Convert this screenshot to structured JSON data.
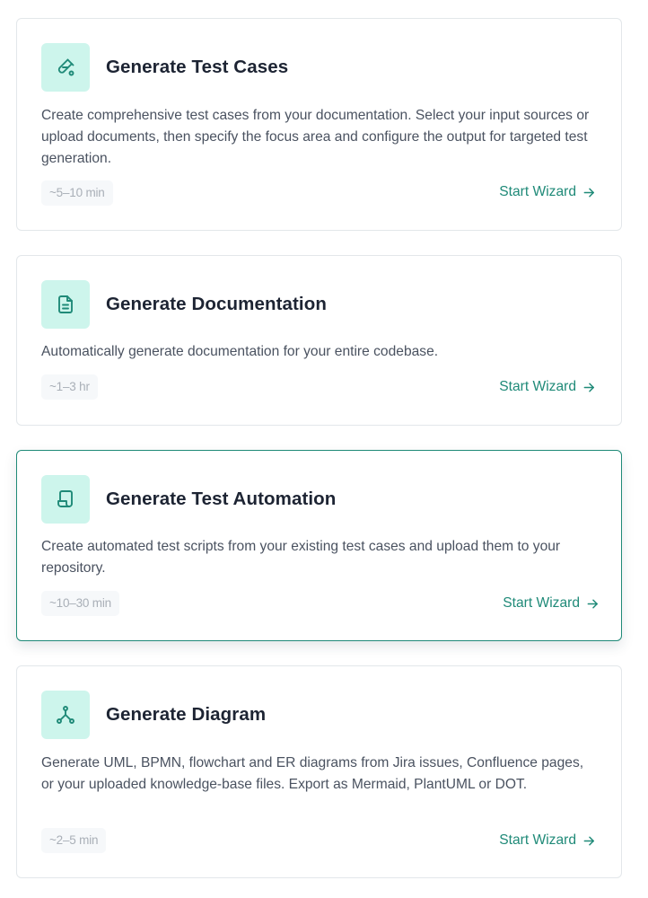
{
  "colors": {
    "accent": "#1f8a78",
    "icon_bg": "#cdf5ec",
    "title": "#1d2433",
    "body_text": "#4a5260",
    "badge_bg": "#f6f8fa",
    "badge_text": "#a9afb7",
    "card_border": "#e3e7ea"
  },
  "cards": [
    {
      "icon": "flask-icon",
      "title": "Generate Test Cases",
      "description": "Create comprehensive test cases from your documentation. Select your input sources or upload documents, then specify the focus area and configure the output for targeted test generation.",
      "duration": "~5–10 min",
      "action_label": "Start Wizard",
      "action_icon": "arrow-right-icon"
    },
    {
      "icon": "document-icon",
      "title": "Generate Documentation",
      "description": "Automatically generate documentation for your entire codebase.",
      "duration": "~1–3 hr",
      "action_label": "Start Wizard",
      "action_icon": "arrow-right-icon"
    },
    {
      "icon": "script-icon",
      "title": "Generate Test Automation",
      "description": "Create automated test scripts from your existing test cases and upload them to your repository.",
      "duration": "~10–30 min",
      "action_label": "Start Wizard",
      "action_icon": "arrow-right-icon",
      "state": "hovered"
    },
    {
      "icon": "diagram-icon",
      "title": "Generate Diagram",
      "description": "Generate UML, BPMN, flowchart and ER diagrams from Jira issues, Confluence pages, or your uploaded knowledge-base files. Export as Mermaid, PlantUML or DOT.",
      "duration": "~2–5 min",
      "action_label": "Start Wizard",
      "action_icon": "arrow-right-icon"
    }
  ]
}
